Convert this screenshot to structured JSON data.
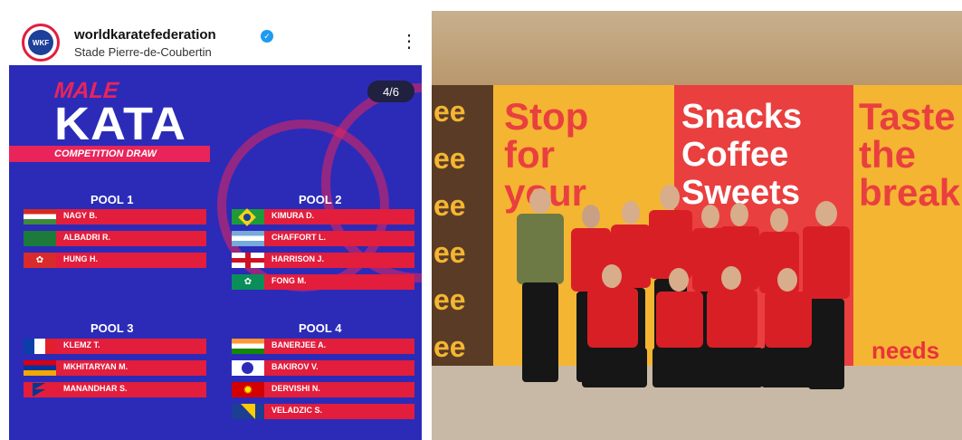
{
  "post": {
    "account": "worldkaratefederation",
    "location": "Stade Pierre-de-Coubertin",
    "logo_text": "WKF",
    "counter": "4/6",
    "title_top": "MALE",
    "title_main": "KATA",
    "subtitle": "COMPETITION DRAW",
    "pools": [
      {
        "title": "POOL 1",
        "entries": [
          {
            "name": "NAGY B.",
            "flag": "hungary"
          },
          {
            "name": "ALBADRI R.",
            "flag": "saudi-arabia"
          },
          {
            "name": "HUNG H.",
            "flag": "hong-kong"
          }
        ]
      },
      {
        "title": "POOL 2",
        "entries": [
          {
            "name": "KIMURA D.",
            "flag": "brazil"
          },
          {
            "name": "CHAFFORT L.",
            "flag": "argentina"
          },
          {
            "name": "HARRISON J.",
            "flag": "england"
          },
          {
            "name": "FONG M.",
            "flag": "macau"
          }
        ]
      },
      {
        "title": "POOL 3",
        "entries": [
          {
            "name": "KLEMZ T.",
            "flag": "france"
          },
          {
            "name": "MKHITARYAN M.",
            "flag": "armenia"
          },
          {
            "name": "MANANDHAR S.",
            "flag": "nepal"
          }
        ]
      },
      {
        "title": "POOL 4",
        "entries": [
          {
            "name": "BANERJEE A.",
            "flag": "india"
          },
          {
            "name": "BAKIROV V.",
            "flag": "kazakhstan"
          },
          {
            "name": "DERVISHI N.",
            "flag": "north-macedonia"
          },
          {
            "name": "VELADZIC S.",
            "flag": "bosnia"
          }
        ]
      }
    ],
    "colors": {
      "card": "#2b2bb8",
      "accent": "#e9245a",
      "row": "#e31d3c"
    }
  },
  "photo": {
    "banner_left": [
      "Stop",
      "for",
      "your"
    ],
    "banner_mid": [
      "Snacks",
      "Coffee",
      "Sweets"
    ],
    "banner_right": [
      "Taste",
      "the",
      "break"
    ],
    "brand": "needs",
    "coffee_text": "ee"
  }
}
